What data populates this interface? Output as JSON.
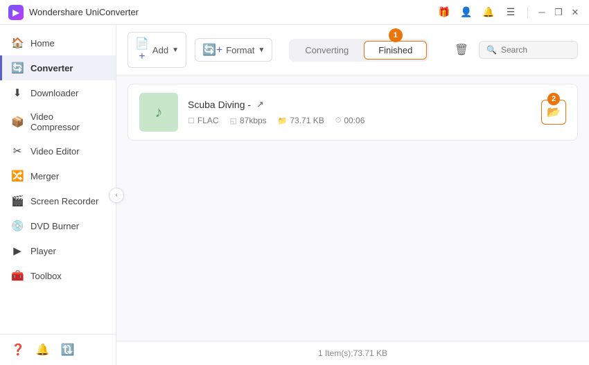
{
  "app": {
    "title": "Wondershare UniConverter",
    "icon_text": "W"
  },
  "titlebar": {
    "icons": [
      "gift-icon",
      "user-icon",
      "bell-icon",
      "menu-icon"
    ],
    "controls": [
      "minimize-icon",
      "restore-icon",
      "close-icon"
    ]
  },
  "sidebar": {
    "items": [
      {
        "id": "home",
        "label": "Home",
        "icon": "🏠"
      },
      {
        "id": "converter",
        "label": "Converter",
        "icon": "🔄",
        "active": true
      },
      {
        "id": "downloader",
        "label": "Downloader",
        "icon": "⬇"
      },
      {
        "id": "video-compressor",
        "label": "Video Compressor",
        "icon": "📦"
      },
      {
        "id": "video-editor",
        "label": "Video Editor",
        "icon": "✂"
      },
      {
        "id": "merger",
        "label": "Merger",
        "icon": "🔀"
      },
      {
        "id": "screen-recorder",
        "label": "Screen Recorder",
        "icon": "🎬"
      },
      {
        "id": "dvd-burner",
        "label": "DVD Burner",
        "icon": "💿"
      },
      {
        "id": "player",
        "label": "Player",
        "icon": "▶"
      },
      {
        "id": "toolbox",
        "label": "Toolbox",
        "icon": "🧰"
      }
    ],
    "bottom_icons": [
      "help-icon",
      "bell-icon",
      "feedback-icon"
    ]
  },
  "toolbar": {
    "add_btn_label": "Add",
    "add_format_label": "Format",
    "tabs": {
      "converting_label": "Converting",
      "finished_label": "Finished"
    },
    "finished_badge": "1",
    "search_placeholder": "Search"
  },
  "file_list": {
    "items": [
      {
        "id": "scuba-diving",
        "name": "Scuba Diving -",
        "format": "FLAC",
        "bitrate": "87kbps",
        "size": "73.71 KB",
        "duration": "00:06",
        "action_badge": "2"
      }
    ]
  },
  "status_bar": {
    "text": "1 Item(s);73.71 KB"
  }
}
